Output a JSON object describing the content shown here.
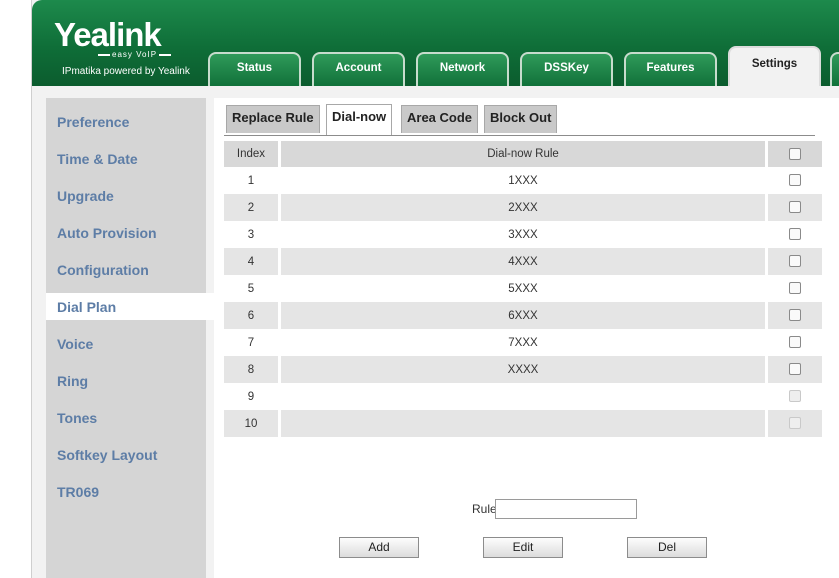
{
  "brand": {
    "logo_text": "Yealink",
    "logo_sub": "easy VoIP",
    "powered_by": "IPmatika powered by Yealink"
  },
  "top_tabs": [
    {
      "label": "Status",
      "active": false
    },
    {
      "label": "Account",
      "active": false
    },
    {
      "label": "Network",
      "active": false
    },
    {
      "label": "DSSKey",
      "active": false
    },
    {
      "label": "Features",
      "active": false
    },
    {
      "label": "Settings",
      "active": true
    }
  ],
  "sidebar": {
    "items": [
      {
        "label": "Preference"
      },
      {
        "label": "Time & Date"
      },
      {
        "label": "Upgrade"
      },
      {
        "label": "Auto Provision"
      },
      {
        "label": "Configuration"
      },
      {
        "label": "Dial Plan",
        "active": true
      },
      {
        "label": "Voice"
      },
      {
        "label": "Ring"
      },
      {
        "label": "Tones"
      },
      {
        "label": "Softkey Layout"
      },
      {
        "label": "TR069"
      }
    ]
  },
  "sub_tabs": [
    {
      "label": "Replace Rule",
      "active": false
    },
    {
      "label": "Dial-now",
      "active": true
    },
    {
      "label": "Area Code",
      "active": false
    },
    {
      "label": "Block Out",
      "active": false
    }
  ],
  "table": {
    "headers": {
      "index": "Index",
      "rule": "Dial-now Rule"
    },
    "rows": [
      {
        "index": "1",
        "rule": "1XXX",
        "enabled": true
      },
      {
        "index": "2",
        "rule": "2XXX",
        "enabled": true
      },
      {
        "index": "3",
        "rule": "3XXX",
        "enabled": true
      },
      {
        "index": "4",
        "rule": "4XXX",
        "enabled": true
      },
      {
        "index": "5",
        "rule": "5XXX",
        "enabled": true
      },
      {
        "index": "6",
        "rule": "6XXX",
        "enabled": true
      },
      {
        "index": "7",
        "rule": "7XXX",
        "enabled": true
      },
      {
        "index": "8",
        "rule": "XXXX",
        "enabled": true
      },
      {
        "index": "9",
        "rule": "",
        "enabled": false
      },
      {
        "index": "10",
        "rule": "",
        "enabled": false
      }
    ]
  },
  "form": {
    "rule_label": "Rule",
    "rule_value": ""
  },
  "buttons": {
    "add": "Add",
    "edit": "Edit",
    "del": "Del"
  }
}
